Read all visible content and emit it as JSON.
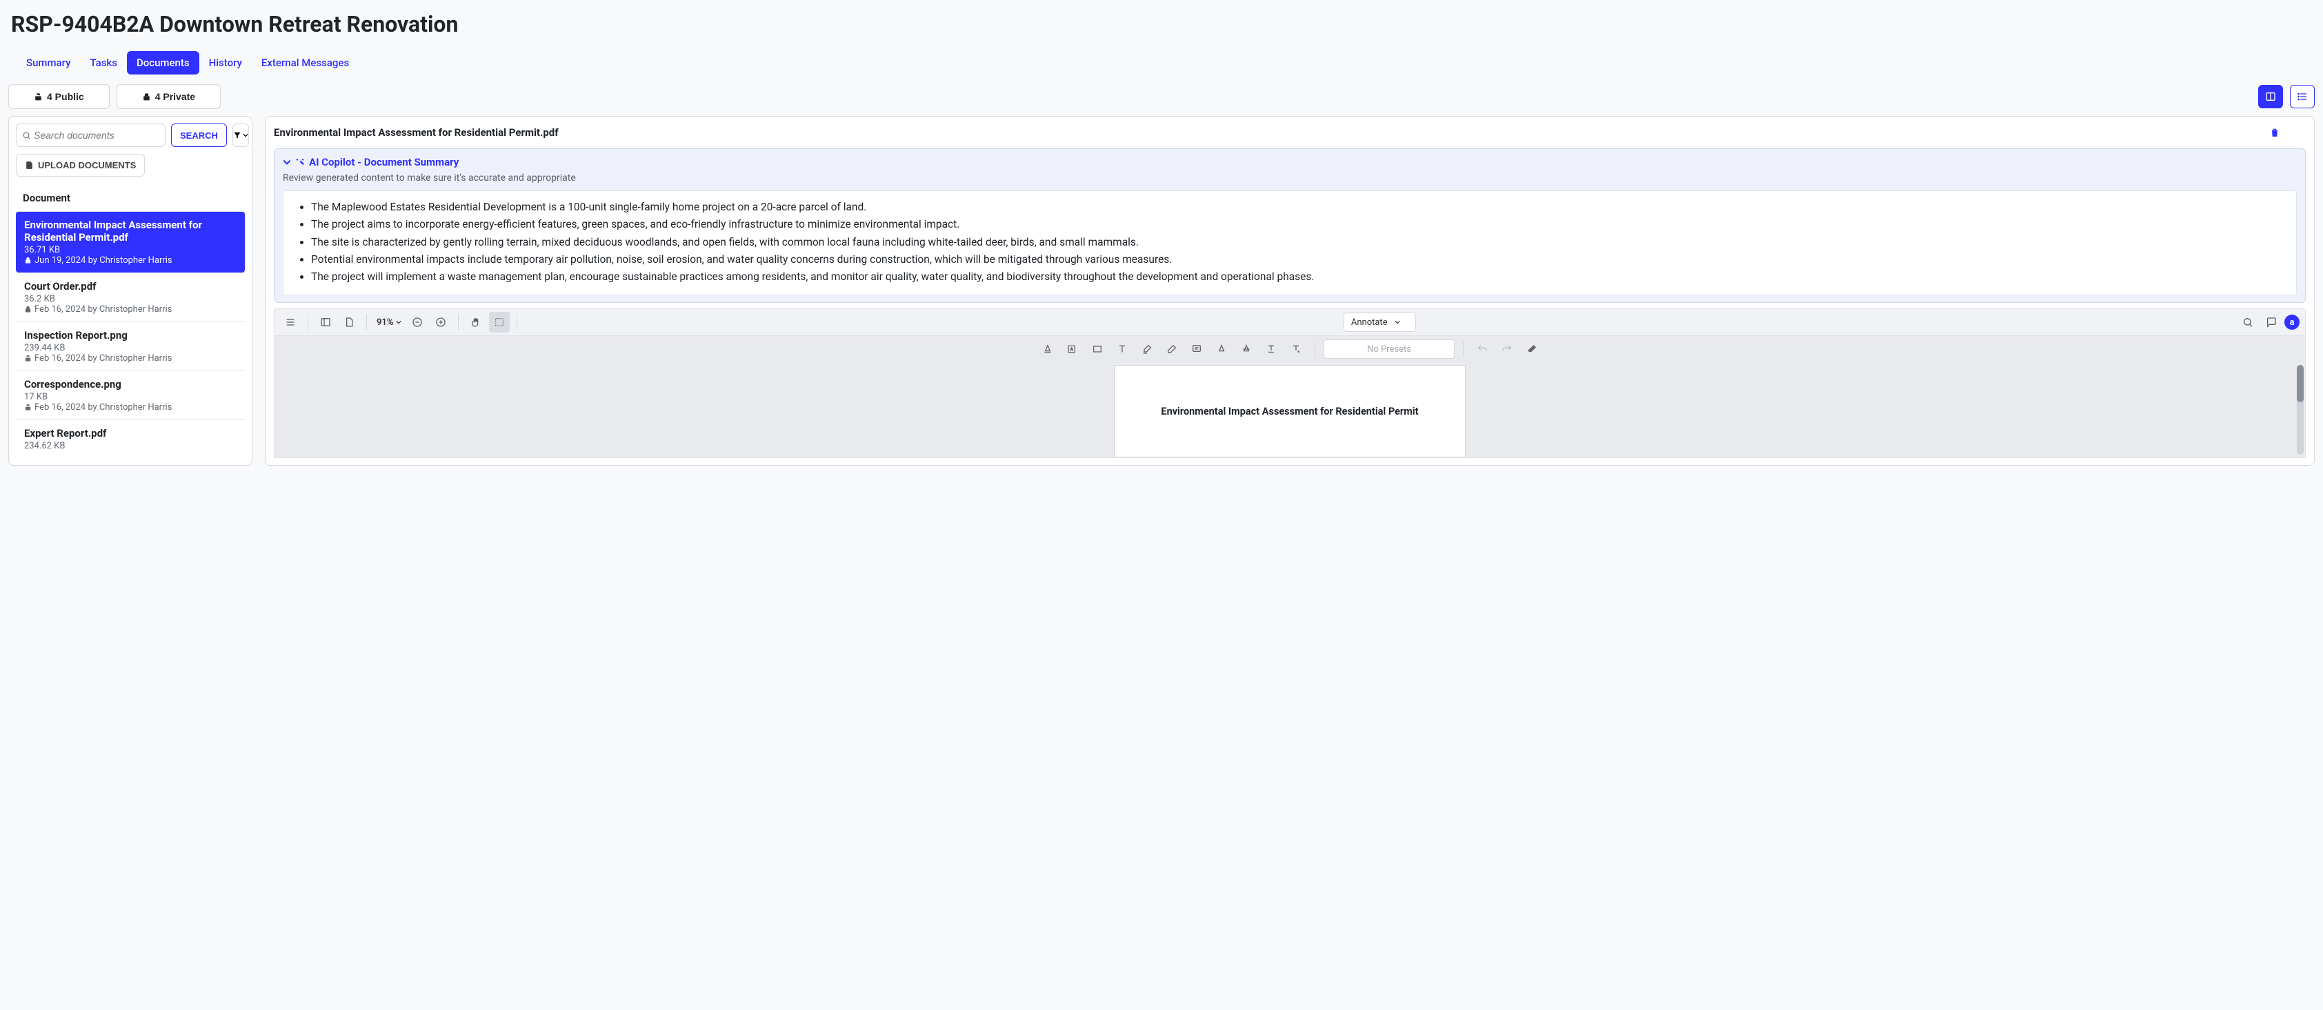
{
  "page_title": "RSP-9404B2A Downtown Retreat Renovation",
  "tabs": [
    {
      "label": "Summary",
      "active": false
    },
    {
      "label": "Tasks",
      "active": false
    },
    {
      "label": "Documents",
      "active": true
    },
    {
      "label": "History",
      "active": false
    },
    {
      "label": "External Messages",
      "active": false
    }
  ],
  "visibility": {
    "public_label": "4 Public",
    "private_label": "4 Private"
  },
  "search": {
    "placeholder": "Search documents",
    "button_label": "SEARCH"
  },
  "upload_label": "UPLOAD DOCUMENTS",
  "doc_list_header": "Document",
  "documents": [
    {
      "name": "Environmental Impact Assessment for Residential Permit.pdf",
      "size": "36.71 KB",
      "date": "Jun 19, 2024",
      "by": "Christopher Harris",
      "private": true,
      "selected": true
    },
    {
      "name": "Court Order.pdf",
      "size": "36.2 KB",
      "date": "Feb 16, 2024",
      "by": "Christopher Harris",
      "private": true,
      "selected": false
    },
    {
      "name": "Inspection Report.png",
      "size": "239.44 KB",
      "date": "Feb 16, 2024",
      "by": "Christopher Harris",
      "private": false,
      "selected": false
    },
    {
      "name": "Correspondence.png",
      "size": "17 KB",
      "date": "Feb 16, 2024",
      "by": "Christopher Harris",
      "private": false,
      "selected": false
    },
    {
      "name": "Expert Report.pdf",
      "size": "234.62 KB",
      "date": "",
      "by": "",
      "private": true,
      "selected": false
    }
  ],
  "content": {
    "title": "Environmental Impact Assessment for Residential Permit.pdf",
    "copilot_title": "AI Copilot - Document Summary",
    "copilot_note": "Review generated content to make sure it's accurate and appropriate",
    "summary": [
      "The Maplewood Estates Residential Development is a 100-unit single-family home project on a 20-acre parcel of land.",
      "The project aims to incorporate energy-efficient features, green spaces, and eco-friendly infrastructure to minimize environmental impact.",
      "The site is characterized by gently rolling terrain, mixed deciduous woodlands, and open fields, with common local fauna including white-tailed deer, birds, and small mammals.",
      "Potential environmental impacts include temporary air pollution, noise, soil erosion, and water quality concerns during construction, which will be mitigated through various measures.",
      "The project will implement a waste management plan, encourage sustainable practices among residents, and monitor air quality, water quality, and biodiversity throughout the development and operational phases."
    ],
    "viewer": {
      "zoom": "91%",
      "annotate_label": "Annotate",
      "presets_label": "No Presets",
      "page_heading": "Environmental Impact Assessment for Residential Permit"
    }
  }
}
